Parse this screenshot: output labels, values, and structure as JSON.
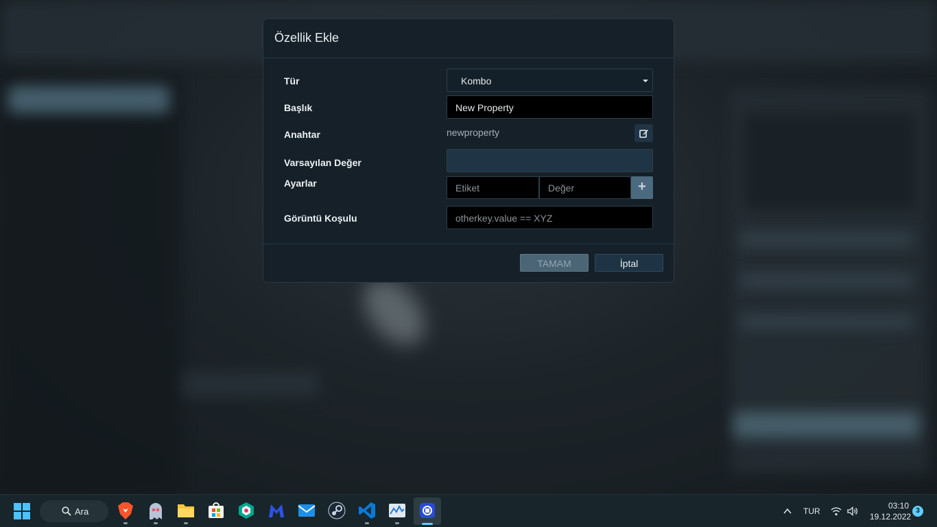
{
  "dialog": {
    "title": "Özellik Ekle",
    "fields": {
      "type": {
        "label": "Tür",
        "value": "Kombo"
      },
      "title": {
        "label": "Başlık",
        "value": "New Property"
      },
      "key": {
        "label": "Anahtar",
        "value": "newproperty"
      },
      "default_value": {
        "label": "Varsayılan Değer",
        "value": ""
      },
      "settings": {
        "label": "Ayarlar",
        "label_placeholder": "Etiket",
        "value_placeholder": "Değer",
        "add_button": "+"
      },
      "display_condition": {
        "label": "Görüntü Koşulu",
        "placeholder": "otherkey.value == XYZ"
      }
    },
    "buttons": {
      "ok": "TAMAM",
      "cancel": "İptal"
    }
  },
  "taskbar": {
    "search_label": "Ara",
    "apps": [
      "start-button",
      "brave",
      "ghost-app",
      "file-explorer",
      "microsoft-store",
      "kaspersky",
      "malwarebytes",
      "mail",
      "steam",
      "vscode",
      "task-manager",
      "active-app"
    ],
    "language": "TUR",
    "time": "03:10",
    "date": "19.12.2022",
    "notification_count": "3"
  },
  "colors": {
    "dialog_bg": "#152028",
    "accent": "#60cdff",
    "ok_button": "#4a6575",
    "cancel_button": "#1e3444"
  }
}
